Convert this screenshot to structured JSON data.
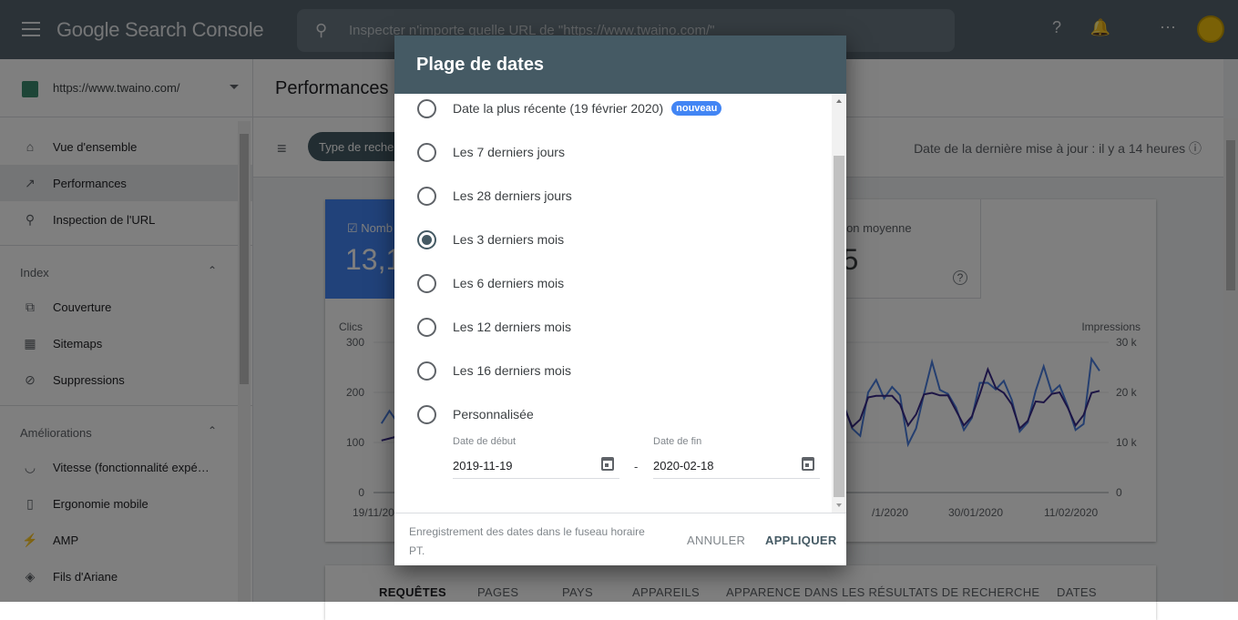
{
  "header": {
    "app_title": "Google Search Console",
    "search_placeholder": "Inspecter n'importe quelle URL de \"https://www.twaino.com/\""
  },
  "sidebar": {
    "property": "https://www.twaino.com/",
    "top_items": [
      {
        "label": "Vue d'ensemble",
        "icon": "home-icon"
      },
      {
        "label": "Performances",
        "icon": "trending-up-icon",
        "selected": true
      },
      {
        "label": "Inspection de l'URL",
        "icon": "search-icon"
      }
    ],
    "sections": [
      {
        "title": "Index",
        "items": [
          {
            "label": "Couverture",
            "icon": "copy-icon"
          },
          {
            "label": "Sitemaps",
            "icon": "sitemap-icon"
          },
          {
            "label": "Suppressions",
            "icon": "eye-off-icon"
          }
        ]
      },
      {
        "title": "Améliorations",
        "items": [
          {
            "label": "Vitesse (fonctionnalité expé…",
            "icon": "speed-icon"
          },
          {
            "label": "Ergonomie mobile",
            "icon": "phone-icon"
          },
          {
            "label": "AMP",
            "icon": "bolt-icon"
          },
          {
            "label": "Fils d'Ariane",
            "icon": "layers-icon"
          }
        ]
      }
    ]
  },
  "main": {
    "title": "Performances",
    "filter_chip": "Type de recherche",
    "last_update": "Date de la dernière mise à jour : il y a 14 heures",
    "metrics": [
      {
        "label": "Nomb",
        "value": "13,1",
        "checked": true,
        "color": "#4285f4"
      },
      {
        "label": "Position moyenne",
        "value": "22,5",
        "checked": false
      }
    ],
    "tabs": [
      "REQUÊTES",
      "PAGES",
      "PAYS",
      "APPAREILS",
      "APPARENCE DANS LES RÉSULTATS DE RECHERCHE",
      "DATES"
    ]
  },
  "chart_data": {
    "type": "line",
    "x_start": "2019-11-19",
    "x_end": "2020-02-18",
    "x_ticks": [
      "19/11/20",
      "/1/2020",
      "30/01/2020",
      "11/02/2020"
    ],
    "y_left": {
      "label": "Clics",
      "ticks": [
        "300",
        "200",
        "100",
        "0"
      ],
      "range": [
        0,
        300
      ]
    },
    "y_right": {
      "label": "Impressions",
      "ticks": [
        "30 k",
        "20 k",
        "10 k",
        "0"
      ],
      "range": [
        0,
        30000
      ]
    },
    "grid": true,
    "series": [
      {
        "axis": "left",
        "color": "#4a7fe0",
        "segments": [
          {
            "start": "2019-11-20",
            "values": [
              138,
              163,
              140
            ]
          },
          {
            "start": "2020-01-17",
            "values": [
              173,
              128,
              113,
              200,
              225,
              188,
              211,
              194,
              96,
              128,
              197,
              261,
              205,
              197,
              170,
              125,
              149,
              219,
              219,
              206,
              223,
              185,
              122,
              140,
              203,
              252,
              200,
              214,
              173,
              125,
              137,
              267,
              243
            ]
          }
        ]
      },
      {
        "axis": "right",
        "color": "#3b2a8a",
        "segments": [
          {
            "start": "2019-11-20",
            "values": [
              10400,
              10800,
              11200
            ]
          },
          {
            "start": "2020-01-17",
            "values": [
              17000,
              13100,
              14600,
              19000,
              19300,
              19300,
              19300,
              17600,
              13400,
              15600,
              19600,
              19900,
              19400,
              19400,
              16400,
              13400,
              15200,
              19700,
              24600,
              20900,
              19900,
              17600,
              12800,
              14300,
              18200,
              18000,
              19700,
              20000,
              17000,
              13400,
              15500,
              19900,
              20300
            ]
          }
        ]
      }
    ]
  },
  "dialog": {
    "title": "Plage de dates",
    "options": [
      {
        "label": "Date la plus récente (19 février 2020)",
        "badge": "nouveau"
      },
      {
        "label": "Les 7 derniers jours"
      },
      {
        "label": "Les 28 derniers jours"
      },
      {
        "label": "Les 3 derniers mois",
        "selected": true
      },
      {
        "label": "Les 6 derniers mois"
      },
      {
        "label": "Les 12 derniers mois"
      },
      {
        "label": "Les 16 derniers mois"
      },
      {
        "label": "Personnalisée"
      }
    ],
    "start_label": "Date de début",
    "start_value": "2019-11-19",
    "end_label": "Date de fin",
    "end_value": "2020-02-18",
    "separator": "-",
    "note": "Enregistrement des dates dans le fuseau horaire PT.",
    "cancel": "ANNULER",
    "apply": "APPLIQUER"
  }
}
